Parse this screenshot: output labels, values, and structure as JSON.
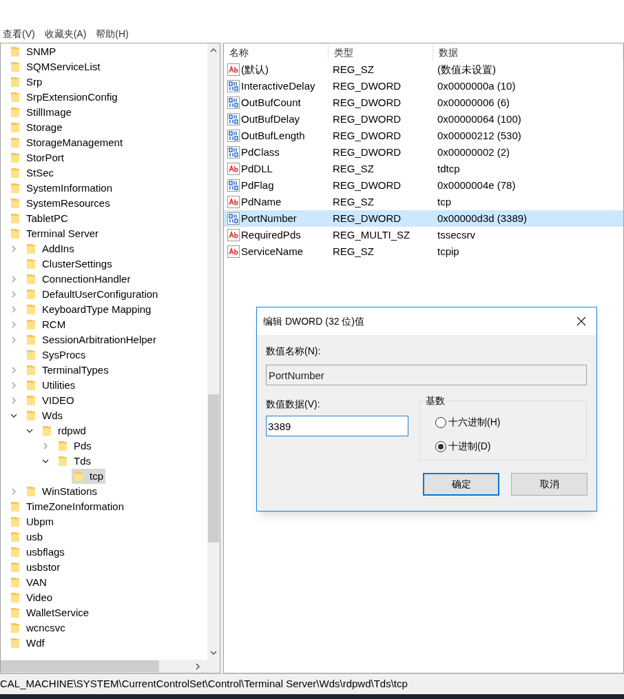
{
  "menu": [
    "查看(V)",
    "收藏夹(A)",
    "帮助(H)"
  ],
  "tree": [
    {
      "label": "SNMP"
    },
    {
      "label": "SQMServiceList"
    },
    {
      "label": "Srp"
    },
    {
      "label": "SrpExtensionConfig"
    },
    {
      "label": "StillImage"
    },
    {
      "label": "Storage"
    },
    {
      "label": "StorageManagement"
    },
    {
      "label": "StorPort"
    },
    {
      "label": "StSec"
    },
    {
      "label": "SystemInformation"
    },
    {
      "label": "SystemResources"
    },
    {
      "label": "TabletPC"
    },
    {
      "label": "Terminal Server",
      "children": [
        {
          "label": "AddIns",
          "expanded": false
        },
        {
          "label": "ClusterSettings"
        },
        {
          "label": "ConnectionHandler",
          "expanded": false
        },
        {
          "label": "DefaultUserConfiguration",
          "expanded": false
        },
        {
          "label": "KeyboardType Mapping",
          "expanded": false
        },
        {
          "label": "RCM",
          "expanded": false
        },
        {
          "label": "SessionArbitrationHelper",
          "expanded": false
        },
        {
          "label": "SysProcs"
        },
        {
          "label": "TerminalTypes",
          "expanded": false
        },
        {
          "label": "Utilities",
          "expanded": false
        },
        {
          "label": "VIDEO",
          "expanded": false
        },
        {
          "label": "Wds",
          "expanded": true,
          "children": [
            {
              "label": "rdpwd",
              "expanded": true,
              "children": [
                {
                  "label": "Pds",
                  "expanded": false
                },
                {
                  "label": "Tds",
                  "expanded": true,
                  "children": [
                    {
                      "label": "tcp",
                      "selected": true
                    }
                  ]
                }
              ]
            }
          ]
        },
        {
          "label": "WinStations",
          "expanded": false
        }
      ]
    },
    {
      "label": "TimeZoneInformation"
    },
    {
      "label": "Ubpm"
    },
    {
      "label": "usb"
    },
    {
      "label": "usbflags"
    },
    {
      "label": "usbstor"
    },
    {
      "label": "VAN"
    },
    {
      "label": "Video"
    },
    {
      "label": "WalletService"
    },
    {
      "label": "wcncsvc"
    },
    {
      "label": "Wdf"
    }
  ],
  "list": {
    "columns": [
      "名称",
      "类型",
      "数据"
    ],
    "rows": [
      {
        "kind": "string",
        "name": "(默认)",
        "type": "REG_SZ",
        "data": "(数值未设置)",
        "selected": false
      },
      {
        "kind": "binary",
        "name": "InteractiveDelay",
        "type": "REG_DWORD",
        "data": "0x0000000a (10)",
        "selected": false
      },
      {
        "kind": "binary",
        "name": "OutBufCount",
        "type": "REG_DWORD",
        "data": "0x00000006 (6)",
        "selected": false
      },
      {
        "kind": "binary",
        "name": "OutBufDelay",
        "type": "REG_DWORD",
        "data": "0x00000064 (100)",
        "selected": false
      },
      {
        "kind": "binary",
        "name": "OutBufLength",
        "type": "REG_DWORD",
        "data": "0x00000212 (530)",
        "selected": false
      },
      {
        "kind": "binary",
        "name": "PdClass",
        "type": "REG_DWORD",
        "data": "0x00000002 (2)",
        "selected": false
      },
      {
        "kind": "string",
        "name": "PdDLL",
        "type": "REG_SZ",
        "data": "tdtcp",
        "selected": false
      },
      {
        "kind": "binary",
        "name": "PdFlag",
        "type": "REG_DWORD",
        "data": "0x0000004e (78)",
        "selected": false
      },
      {
        "kind": "string",
        "name": "PdName",
        "type": "REG_SZ",
        "data": "tcp",
        "selected": false
      },
      {
        "kind": "binary",
        "name": "PortNumber",
        "type": "REG_DWORD",
        "data": "0x00000d3d (3389)",
        "selected": true
      },
      {
        "kind": "string",
        "name": "RequiredPds",
        "type": "REG_MULTI_SZ",
        "data": "tssecsrv",
        "selected": false
      },
      {
        "kind": "string",
        "name": "ServiceName",
        "type": "REG_SZ",
        "data": "tcpip",
        "selected": false
      }
    ]
  },
  "dialog": {
    "title": "编辑 DWORD (32 位)值",
    "name_label": "数值名称(N):",
    "name_value": "PortNumber",
    "data_label": "数值数据(V):",
    "data_value": "3389",
    "base_title": "基数",
    "radios": [
      {
        "label": "十六进制(H)",
        "selected": false
      },
      {
        "label": "十进制(D)",
        "selected": true
      }
    ],
    "buttons": [
      {
        "label": "确定",
        "focused": true
      },
      {
        "label": "取消",
        "focused": false
      }
    ]
  },
  "status_bar": "CAL_MACHINE\\SYSTEM\\CurrentControlSet\\Control\\Terminal Server\\Wds\\rdpwd\\Tds\\tcp"
}
